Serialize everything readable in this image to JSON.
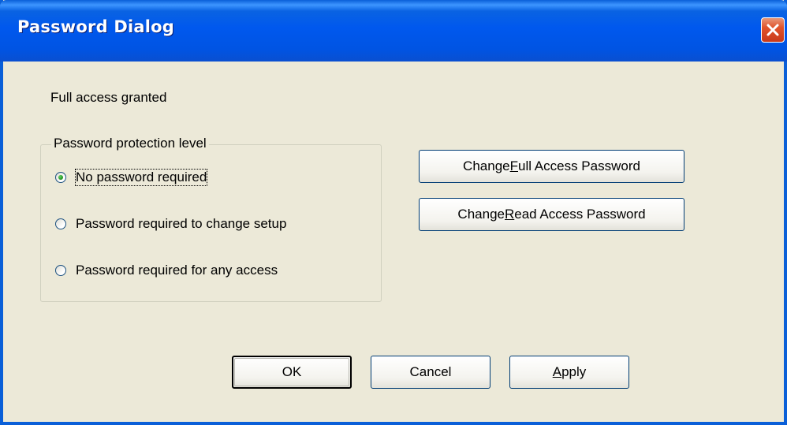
{
  "window": {
    "title": "Password Dialog"
  },
  "status": {
    "text": "Full access granted"
  },
  "protection": {
    "group_label": "Password protection level",
    "options": [
      {
        "label": "No password required",
        "checked": true
      },
      {
        "label": "Password required to change setup",
        "checked": false
      },
      {
        "label": "Password required for any access",
        "checked": false
      }
    ]
  },
  "buttons": {
    "change_full": {
      "pre": "Change ",
      "mnemonic": "F",
      "post": "ull Access Password"
    },
    "change_read": {
      "pre": "Change ",
      "mnemonic": "R",
      "post": "ead Access Password"
    },
    "ok": "OK",
    "cancel": "Cancel",
    "apply": {
      "pre": "",
      "mnemonic": "A",
      "post": "pply"
    }
  },
  "icons": {
    "close": "close-icon",
    "radio_selected_color": "#21a121"
  }
}
